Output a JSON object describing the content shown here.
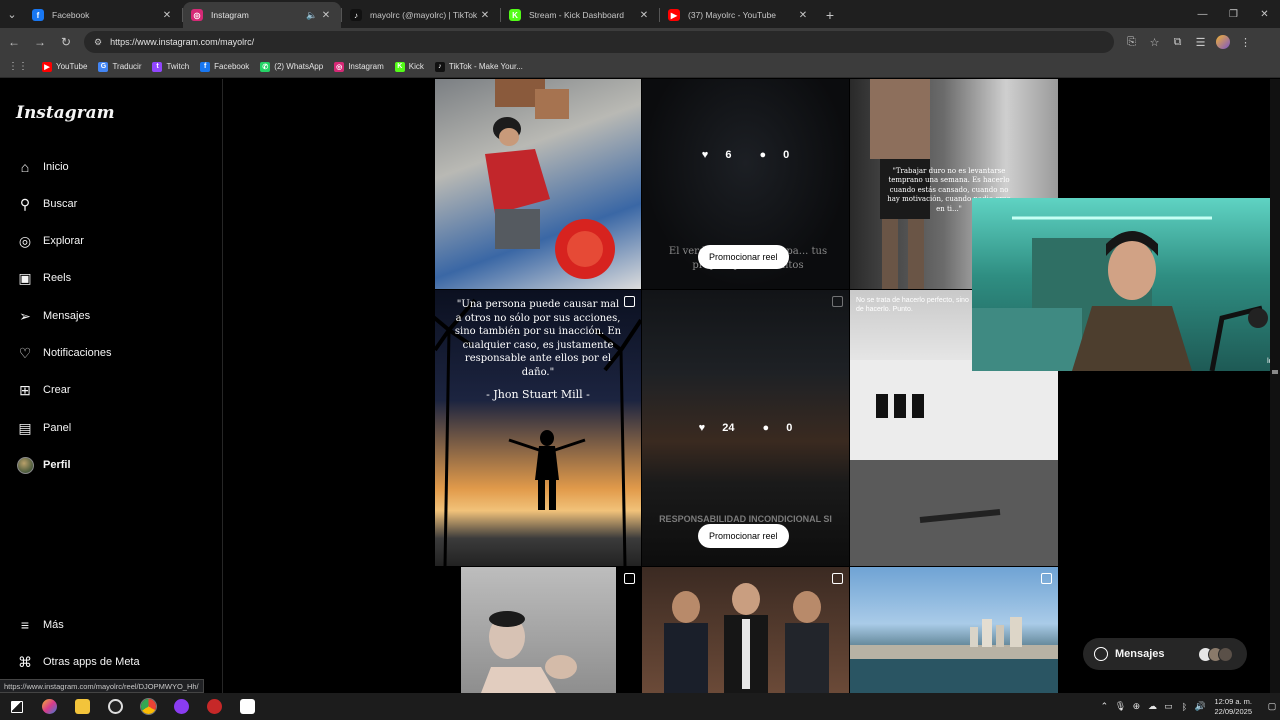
{
  "browser": {
    "tabs": [
      {
        "title": "Facebook",
        "favicon": "facebook-icon",
        "color": "#1877f2",
        "glyph": "f",
        "active": false
      },
      {
        "title": "Instagram",
        "favicon": "instagram-icon",
        "color": "#d62976",
        "glyph": "◎",
        "active": true
      },
      {
        "title": "mayolrc (@mayolrc) | TikTok",
        "favicon": "tiktok-icon",
        "color": "#111111",
        "glyph": "♪",
        "active": false
      },
      {
        "title": "Stream - Kick Dashboard",
        "favicon": "kick-icon",
        "color": "#53fc18",
        "glyph": "K",
        "active": false
      },
      {
        "title": "(37) Mayolrc - YouTube",
        "favicon": "youtube-icon",
        "color": "#ff0000",
        "glyph": "▶",
        "active": false
      }
    ],
    "url": "https://www.instagram.com/mayolrc/",
    "bookmarks": [
      {
        "label": "YouTube",
        "color": "#ff0000",
        "glyph": "▶"
      },
      {
        "label": "Traducir",
        "color": "#4285f4",
        "glyph": "G"
      },
      {
        "label": "Twitch",
        "color": "#9146ff",
        "glyph": "t"
      },
      {
        "label": "Facebook",
        "color": "#1877f2",
        "glyph": "f"
      },
      {
        "label": "(2) WhatsApp",
        "color": "#25d366",
        "glyph": "✆"
      },
      {
        "label": "Instagram",
        "color": "#d62976",
        "glyph": "◎"
      },
      {
        "label": "Kick",
        "color": "#53fc18",
        "glyph": "K"
      },
      {
        "label": "TikTok - Make Your...",
        "color": "#111111",
        "glyph": "♪"
      }
    ],
    "status_url": "https://www.instagram.com/mayolrc/reel/DJOPMWYO_Hh/"
  },
  "sidebar": {
    "logo": "Instagram",
    "items": [
      {
        "label": "Inicio",
        "icon": "home-icon",
        "glyph": "⌂"
      },
      {
        "label": "Buscar",
        "icon": "search-icon",
        "glyph": "⚲"
      },
      {
        "label": "Explorar",
        "icon": "compass-icon",
        "glyph": "◎"
      },
      {
        "label": "Reels",
        "icon": "reels-icon",
        "glyph": "▣"
      },
      {
        "label": "Mensajes",
        "icon": "messages-icon",
        "glyph": "➢"
      },
      {
        "label": "Notificaciones",
        "icon": "heart-icon",
        "glyph": "♡"
      },
      {
        "label": "Crear",
        "icon": "create-icon",
        "glyph": "⊞"
      },
      {
        "label": "Panel",
        "icon": "dashboard-icon",
        "glyph": "▤"
      },
      {
        "label": "Perfil",
        "icon": "profile-avatar",
        "glyph": ""
      }
    ],
    "more": {
      "label": "Más",
      "icon": "menu-icon",
      "glyph": "≡"
    },
    "meta": {
      "label": "Otras apps de Meta",
      "icon": "meta-apps-icon",
      "glyph": "⌘"
    }
  },
  "posts": {
    "p2": {
      "likes": "6",
      "comments": "0",
      "promote": "Promocionar reel",
      "caption": "El verdadero... en la capa... tus propios pensamientos"
    },
    "p3": {
      "quote": "\"Trabajar duro no es levantarse temprano una semana. Es hacerlo cuando estás cansado, cuando no hay motivación, cuando nadie cree en ti...\""
    },
    "p4": {
      "quote": "\"Una persona puede causar mal a otros no sólo por sus acciones, sino también por su inacción. En cualquier caso, es justamente responsable ante ellos por el daño.\"",
      "author": "- Jhon Stuart Mill -"
    },
    "p5": {
      "likes": "24",
      "comments": "0",
      "promote": "Promocionar reel",
      "caption": "RESPONSABILIDAD INCONDICIONAL SI"
    },
    "p6": {
      "caption": "No se trata de hacerlo perfecto, sino de hacerlo. Punto."
    }
  },
  "webcam": {
    "label": "logi"
  },
  "messages_pill": {
    "label": "Mensajes"
  },
  "taskbar": {
    "time": "12:09 a. m.",
    "date": "22/09/2025"
  }
}
